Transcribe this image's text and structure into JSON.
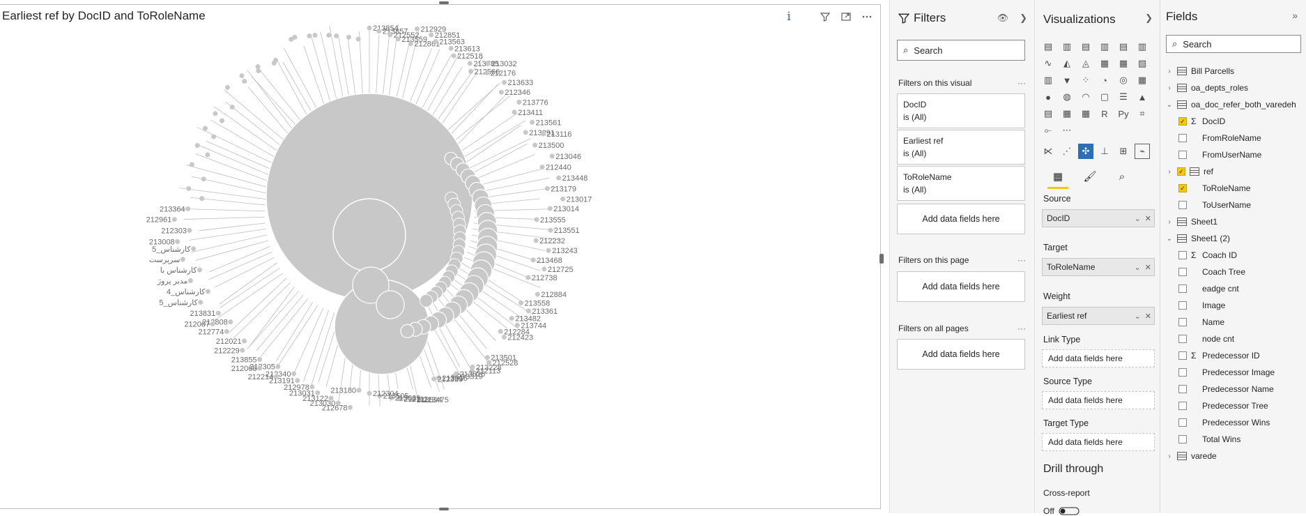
{
  "visual": {
    "title": "Earliest ref by DocID and ToRoleName",
    "info_label": "i",
    "node_color": "#c8c8c8",
    "labels": [
      {
        "t": "213854"
      },
      {
        "t": "213857"
      },
      {
        "t": "212552"
      },
      {
        "t": "213559"
      },
      {
        "t": "212861"
      },
      {
        "t": "212929"
      },
      {
        "t": "212851"
      },
      {
        "t": "213563"
      },
      {
        "t": "213613"
      },
      {
        "t": "212518"
      },
      {
        "t": "213785"
      },
      {
        "t": "212566"
      },
      {
        "t": "213032"
      },
      {
        "t": "212176"
      },
      {
        "t": "213633"
      },
      {
        "t": "212346"
      },
      {
        "t": "213776"
      },
      {
        "t": "213411"
      },
      {
        "t": "213561"
      },
      {
        "t": "213291"
      },
      {
        "t": "213116"
      },
      {
        "t": "213500"
      },
      {
        "t": "213046"
      },
      {
        "t": "212440"
      },
      {
        "t": "213448"
      },
      {
        "t": "213179"
      },
      {
        "t": "213017"
      },
      {
        "t": "213014"
      },
      {
        "t": "213555"
      },
      {
        "t": "213551"
      },
      {
        "t": "212232"
      },
      {
        "t": "213243"
      },
      {
        "t": "213468"
      },
      {
        "t": "212725"
      },
      {
        "t": "212738"
      },
      {
        "t": "212884"
      },
      {
        "t": "213558"
      },
      {
        "t": "213361"
      },
      {
        "t": "213482"
      },
      {
        "t": "213744"
      },
      {
        "t": "212284"
      },
      {
        "t": "212423"
      },
      {
        "t": "213501"
      },
      {
        "t": "212528"
      },
      {
        "t": "213228"
      },
      {
        "t": "212113"
      },
      {
        "t": "213626"
      },
      {
        "t": "213319"
      },
      {
        "t": "213815"
      },
      {
        "t": "212339"
      },
      {
        "t": "213475"
      },
      {
        "t": "213594"
      },
      {
        "t": "212111"
      },
      {
        "t": "213039"
      },
      {
        "t": "213505"
      },
      {
        "t": "212304"
      },
      {
        "t": "213180"
      },
      {
        "t": "212678"
      },
      {
        "t": "213030"
      },
      {
        "t": "213122"
      },
      {
        "t": "213031"
      },
      {
        "t": "212978"
      },
      {
        "t": "213191"
      },
      {
        "t": "212340"
      },
      {
        "t": "212305"
      },
      {
        "t": "212214"
      },
      {
        "t": "212066"
      },
      {
        "t": "213855"
      },
      {
        "t": "212229"
      },
      {
        "t": "212021"
      },
      {
        "t": "212774"
      },
      {
        "t": "212808"
      },
      {
        "t": "212007"
      },
      {
        "t": "213831"
      },
      {
        "t": "5_کارشناس"
      },
      {
        "t": "کارشناس_4"
      },
      {
        "t": "مدیر پروژ"
      },
      {
        "t": "کارشناس با"
      },
      {
        "t": "سرپرست"
      },
      {
        "t": "کارشناس_5"
      },
      {
        "t": "213008"
      },
      {
        "t": "212303"
      },
      {
        "t": "212961"
      },
      {
        "t": "213364"
      }
    ]
  },
  "filters": {
    "title": "Filters",
    "search_placeholder": "Search",
    "on_visual_label": "Filters on this visual",
    "cards": [
      {
        "field": "DocID",
        "state": "is (All)"
      },
      {
        "field": "Earliest ref",
        "state": "is (All)"
      },
      {
        "field": "ToRoleName",
        "state": "is (All)"
      }
    ],
    "add_fields": "Add data fields here",
    "on_page_label": "Filters on this page",
    "on_all_label": "Filters on all pages",
    "more": "···"
  },
  "viz": {
    "title": "Visualizations",
    "icons": [
      "stacked-bar-chart-icon",
      "stacked-column-chart-icon",
      "clustered-bar-chart-icon",
      "clustered-column-chart-icon",
      "100-bar-chart-icon",
      "100-column-chart-icon",
      "line-chart-icon",
      "area-chart-icon",
      "stacked-area-chart-icon",
      "line-column-chart-icon",
      "line-clustered-column-icon",
      "ribbon-chart-icon",
      "waterfall-chart-icon",
      "funnel-chart-icon",
      "scatter-chart-icon",
      "pie-chart-icon",
      "donut-chart-icon",
      "treemap-icon",
      "map-icon",
      "filled-map-icon",
      "gauge-icon",
      "card-icon",
      "multi-row-card-icon",
      "kpi-icon",
      "slicer-icon",
      "table-icon",
      "matrix-icon",
      "r-visual-icon",
      "python-visual-icon",
      "key-influencers-icon",
      "decomposition-tree-icon",
      "more-visuals-icon"
    ],
    "icon_glyphs": [
      "▤",
      "▥",
      "▤",
      "▥",
      "▤",
      "▥",
      "∿",
      "◭",
      "◬",
      "▦",
      "▦",
      "▧",
      "▥",
      "▼",
      "⁘",
      "◔",
      "◎",
      "▦",
      "●",
      "◍",
      "◠",
      "▢",
      "☰",
      "▲",
      "▤",
      "▦",
      "▦",
      "R",
      "Py",
      "⌗",
      "⟜",
      "⋯"
    ],
    "custom_icons": [
      "network-navigator-icon",
      "force-graph-icon",
      "network-graph-icon",
      "tornado-icon",
      "chiclet-icon",
      "custom-visual-icon"
    ],
    "custom_glyphs": [
      "⋉",
      "⋰",
      "✣",
      "⊥",
      "⊞",
      "⌁"
    ],
    "tab_icons": [
      "fields-tab-icon",
      "format-tab-icon",
      "analytics-tab-icon"
    ],
    "tab_glyphs": [
      "▦",
      "🖌",
      "⌕"
    ],
    "wells": {
      "source_label": "Source",
      "source_value": "DocID",
      "target_label": "Target",
      "target_value": "ToRoleName",
      "weight_label": "Weight",
      "weight_value": "Earliest ref",
      "link_type_label": "Link Type",
      "source_type_label": "Source Type",
      "target_type_label": "Target Type",
      "add_fields": "Add data fields here"
    },
    "drill_title": "Drill through",
    "cross_report": "Cross-report",
    "toggle_off": "Off"
  },
  "fields": {
    "title": "Fields",
    "search_placeholder": "Search",
    "tables": [
      {
        "name": "Bill Parcells",
        "expanded": false
      },
      {
        "name": "oa_depts_roles",
        "expanded": false
      },
      {
        "name": "oa_doc_refer_both_varedeh",
        "expanded": true,
        "items": [
          {
            "name": "DocID",
            "sigma": true,
            "checked": true
          },
          {
            "name": "FromRoleName",
            "sigma": false,
            "checked": false
          },
          {
            "name": "FromUserName",
            "sigma": false,
            "checked": false
          },
          {
            "name": "ref",
            "sigma": false,
            "checked": true,
            "table": true
          },
          {
            "name": "ToRoleName",
            "sigma": false,
            "checked": true
          },
          {
            "name": "ToUserName",
            "sigma": false,
            "checked": false
          }
        ]
      },
      {
        "name": "Sheet1",
        "expanded": false
      },
      {
        "name": "Sheet1 (2)",
        "expanded": true,
        "items": [
          {
            "name": "Coach ID",
            "sigma": true,
            "checked": false
          },
          {
            "name": "Coach Tree",
            "sigma": false,
            "checked": false
          },
          {
            "name": "eadge cnt",
            "sigma": false,
            "checked": false
          },
          {
            "name": "Image",
            "sigma": false,
            "checked": false
          },
          {
            "name": "Name",
            "sigma": false,
            "checked": false
          },
          {
            "name": "node cnt",
            "sigma": false,
            "checked": false
          },
          {
            "name": "Predecessor ID",
            "sigma": true,
            "checked": false
          },
          {
            "name": "Predecessor Image",
            "sigma": false,
            "checked": false
          },
          {
            "name": "Predecessor Name",
            "sigma": false,
            "checked": false
          },
          {
            "name": "Predecessor Tree",
            "sigma": false,
            "checked": false
          },
          {
            "name": "Predecessor Wins",
            "sigma": false,
            "checked": false
          },
          {
            "name": "Total Wins",
            "sigma": false,
            "checked": false
          }
        ]
      },
      {
        "name": "varede",
        "expanded": false
      }
    ]
  }
}
